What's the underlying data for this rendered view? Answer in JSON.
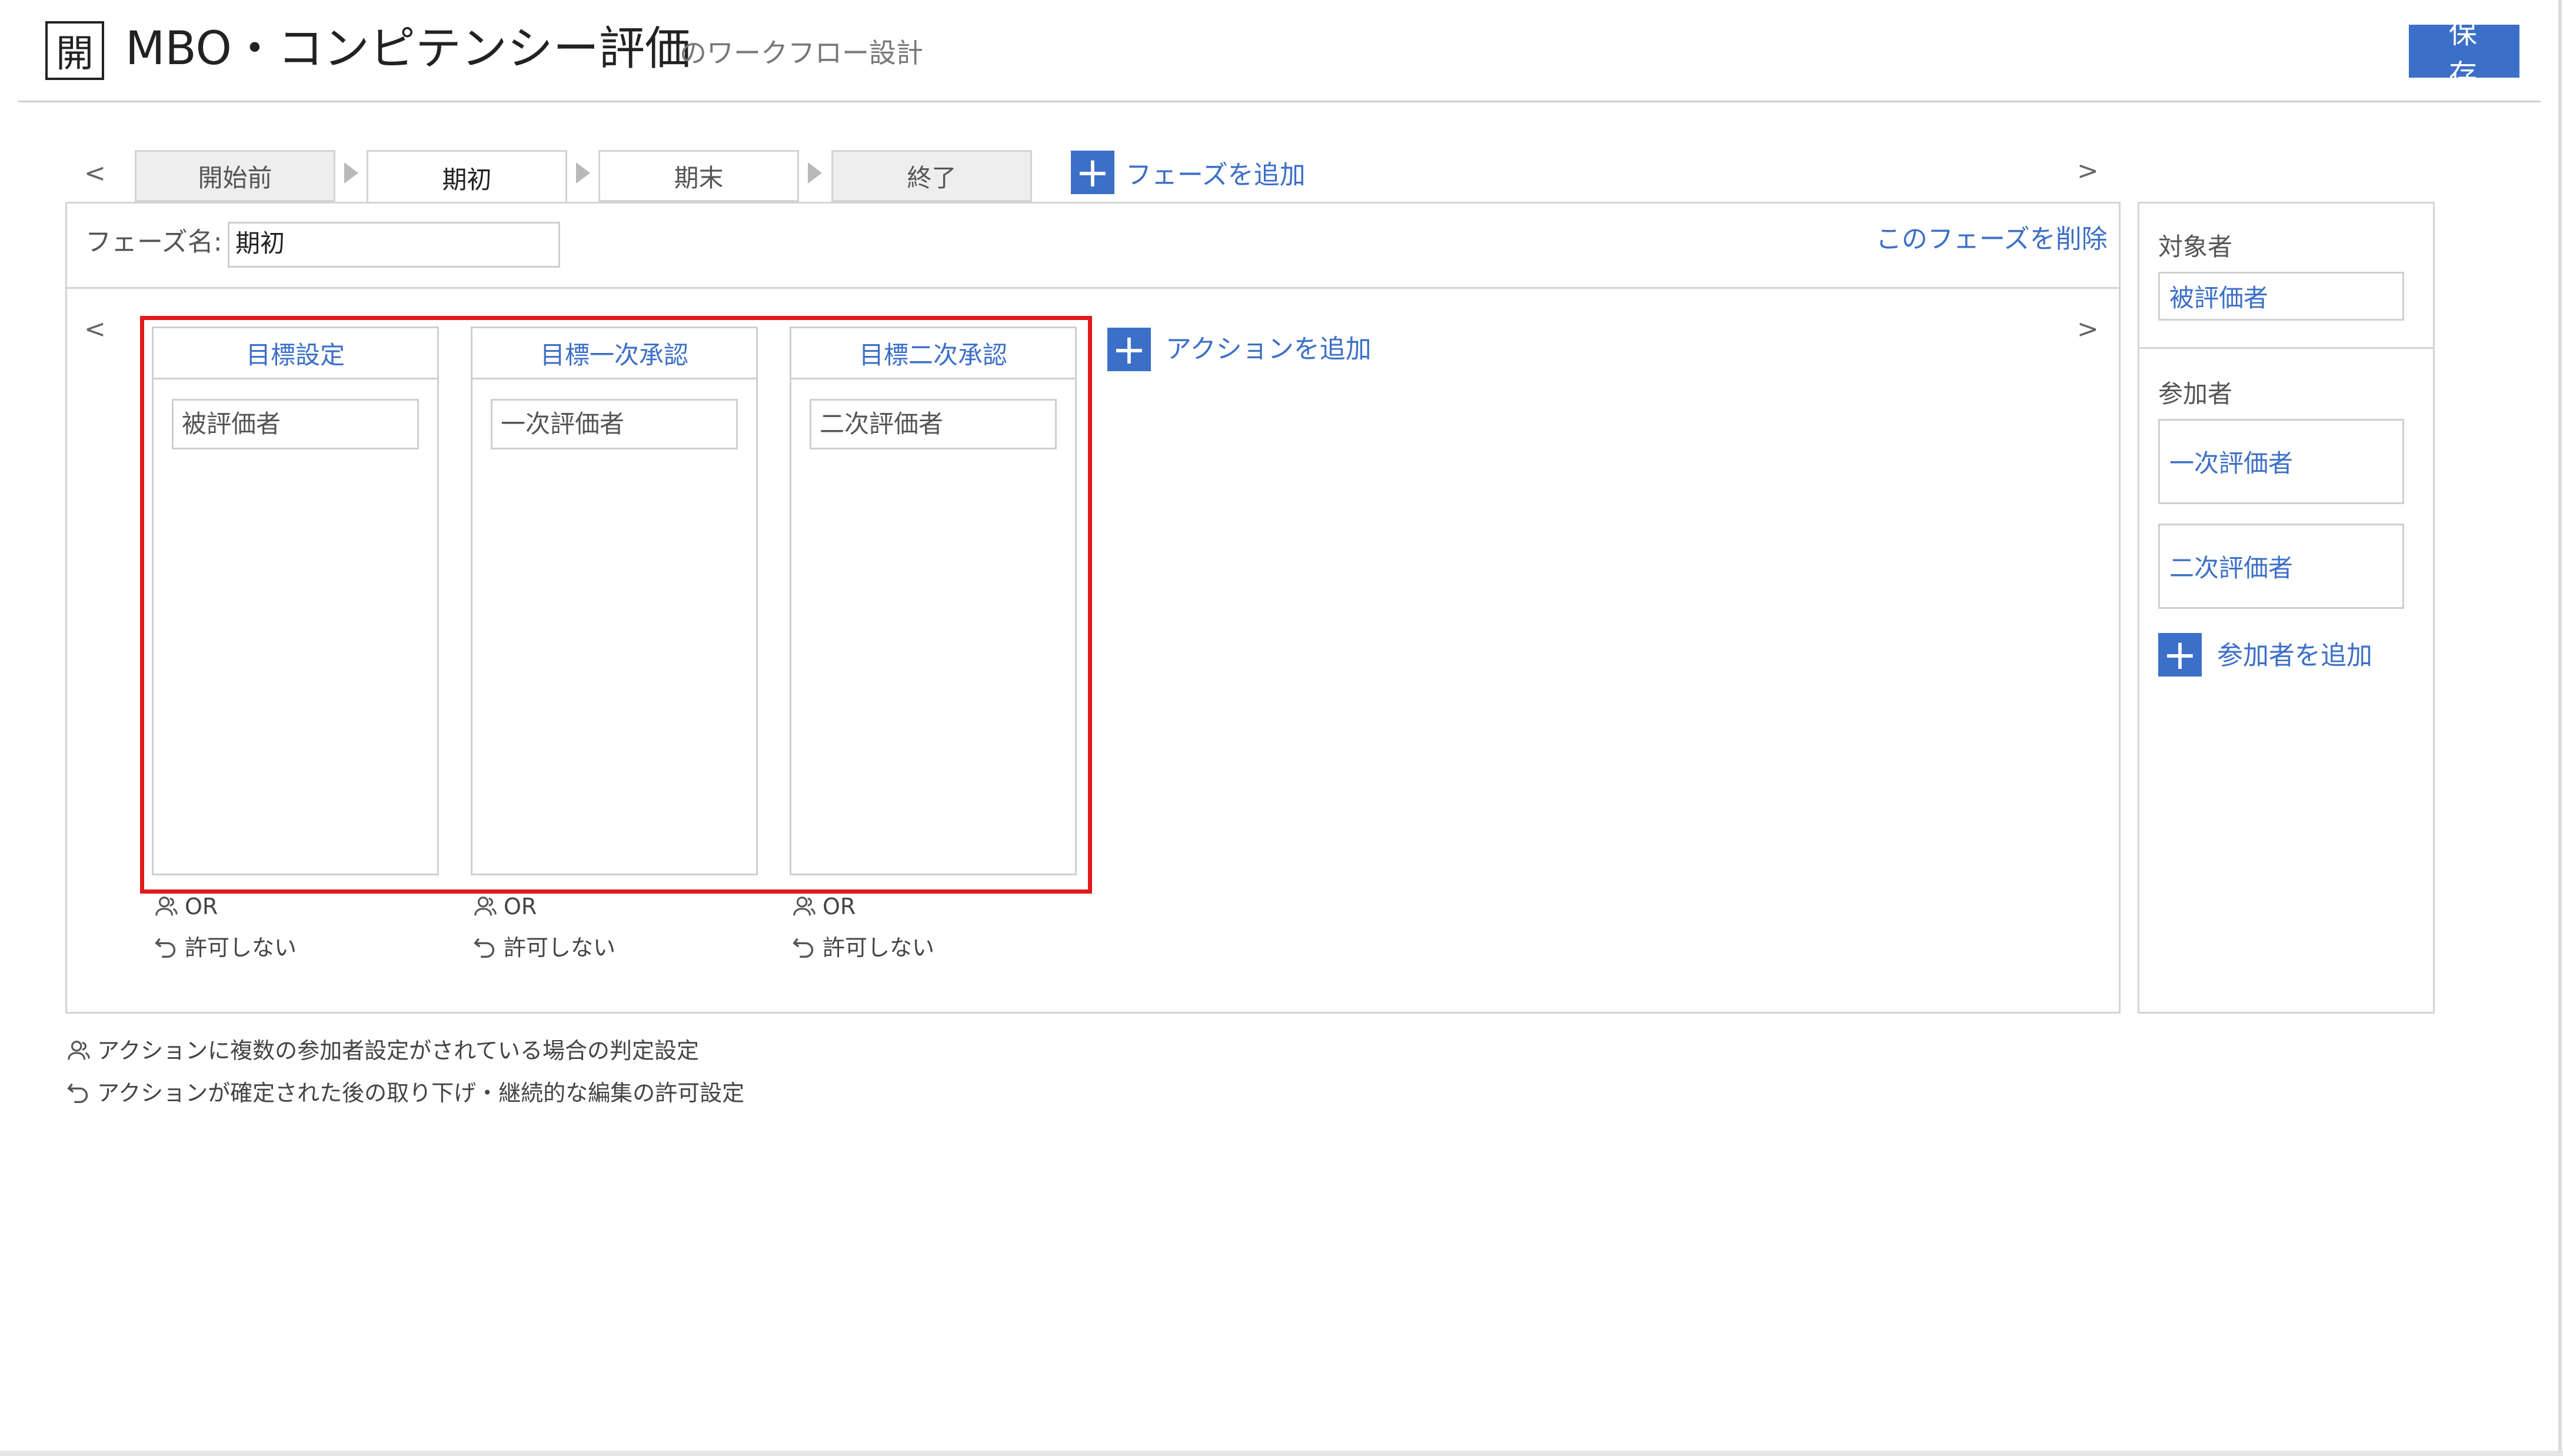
{
  "header": {
    "logo_char": "開",
    "title": "MBO・コンピテンシー評価",
    "subtitle": "のワークフロー設計",
    "save_label": "保 存"
  },
  "phase_tabs": {
    "prev_arrow": "<",
    "next_arrow": ">",
    "tabs": [
      {
        "label": "開始前",
        "active": false
      },
      {
        "label": "期初",
        "active": true
      },
      {
        "label": "期末",
        "active": false
      },
      {
        "label": "終了",
        "active": false
      }
    ],
    "add_phase_label": "フェーズを追加"
  },
  "phase": {
    "name_label": "フェーズ名:",
    "name_value": "期初",
    "delete_label": "このフェーズを削除"
  },
  "actions": {
    "prev_arrow": "<",
    "next_arrow": ">",
    "add_action_label": "アクションを追加",
    "items": [
      {
        "title": "目標設定",
        "participant": "被評価者",
        "judgement": "OR",
        "permission": "許可しない"
      },
      {
        "title": "目標一次承認",
        "participant": "一次評価者",
        "judgement": "OR",
        "permission": "許可しない"
      },
      {
        "title": "目標二次承認",
        "participant": "二次評価者",
        "judgement": "OR",
        "permission": "許可しない"
      }
    ]
  },
  "side_panel": {
    "target_label": "対象者",
    "target_value": "被評価者",
    "participants_label": "参加者",
    "participants": [
      "一次評価者",
      "二次評価者"
    ],
    "add_participant_label": "参加者を追加"
  },
  "legend": {
    "judgement_desc": "アクションに複数の参加者設定がされている場合の判定設定",
    "permission_desc": "アクションが確定された後の取り下げ・継続的な編集の許可設定"
  },
  "colors": {
    "accent": "#3c6fc7",
    "highlight": "#e21a1a",
    "border": "#d4d4d4"
  }
}
